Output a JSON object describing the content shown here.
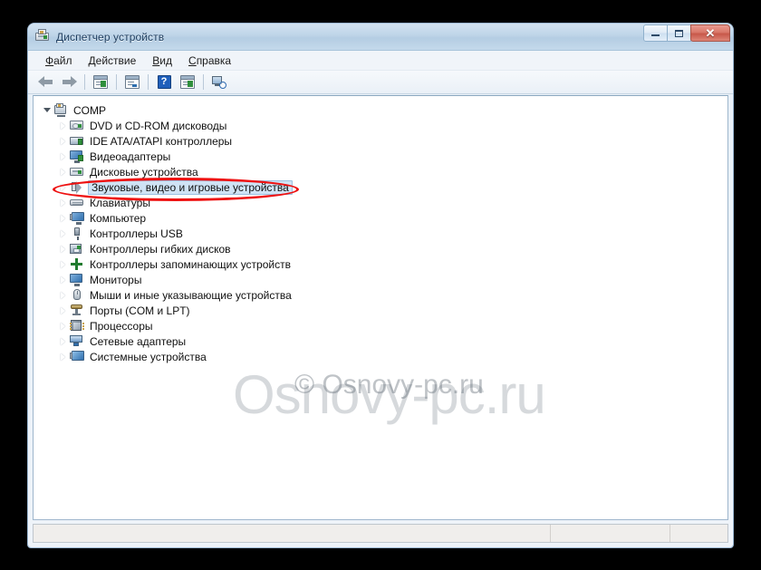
{
  "window": {
    "title": "Диспетчер устройств",
    "title_icon": "device-manager-icon",
    "controls": {
      "minimize": "minimize-button",
      "maximize": "maximize-button",
      "close": "✕"
    }
  },
  "menubar": {
    "items": [
      {
        "label": "Файл",
        "accel": "Ф",
        "rest": "айл"
      },
      {
        "label": "Действие",
        "accel": "Д",
        "rest": "ействие"
      },
      {
        "label": "Вид",
        "accel": "В",
        "rest": "ид"
      },
      {
        "label": "Справка",
        "accel": "С",
        "rest": "правка"
      }
    ]
  },
  "toolbar": {
    "buttons": [
      {
        "name": "back-button",
        "icon": "arrow-left-icon"
      },
      {
        "name": "forward-button",
        "icon": "arrow-right-icon"
      },
      {
        "name": "properties-button",
        "icon": "properties-panel-icon"
      },
      {
        "name": "show-details-button",
        "icon": "details-panel-icon"
      },
      {
        "name": "help-button",
        "icon": "help-icon",
        "glyph": "?"
      },
      {
        "name": "update-driver-button",
        "icon": "update-panel-icon"
      },
      {
        "name": "scan-hardware-button",
        "icon": "scan-hardware-icon"
      }
    ]
  },
  "tree": {
    "root": {
      "label": "COMP",
      "icon": "computer-icon",
      "expanded": true
    },
    "items": [
      {
        "label": "DVD и CD-ROM дисководы",
        "icon": "dvd-drive-icon",
        "selected": false
      },
      {
        "label": "IDE ATA/ATAPI контроллеры",
        "icon": "ide-controller-icon",
        "selected": false
      },
      {
        "label": "Видеоадаптеры",
        "icon": "display-adapter-icon",
        "selected": false
      },
      {
        "label": "Дисковые устройства",
        "icon": "disk-drive-icon",
        "selected": false
      },
      {
        "label": "Звуковые, видео и игровые устройства",
        "icon": "sound-device-icon",
        "selected": true
      },
      {
        "label": "Клавиатуры",
        "icon": "keyboard-icon",
        "selected": false
      },
      {
        "label": "Компьютер",
        "icon": "computer-node-icon",
        "selected": false
      },
      {
        "label": "Контроллеры USB",
        "icon": "usb-controller-icon",
        "selected": false
      },
      {
        "label": "Контроллеры гибких дисков",
        "icon": "floppy-controller-icon",
        "selected": false
      },
      {
        "label": "Контроллеры запоминающих устройств",
        "icon": "storage-controller-icon",
        "selected": false
      },
      {
        "label": "Мониторы",
        "icon": "monitor-icon",
        "selected": false
      },
      {
        "label": "Мыши и иные указывающие устройства",
        "icon": "mouse-icon",
        "selected": false
      },
      {
        "label": "Порты (COM и LPT)",
        "icon": "port-icon",
        "selected": false
      },
      {
        "label": "Процессоры",
        "icon": "cpu-icon",
        "selected": false
      },
      {
        "label": "Сетевые адаптеры",
        "icon": "network-adapter-icon",
        "selected": false
      },
      {
        "label": "Системные устройства",
        "icon": "system-device-icon",
        "selected": false
      }
    ]
  },
  "annotation": {
    "type": "red-ellipse-highlight",
    "target": "Звуковые, видео и игровые устройства",
    "color": "#ee1111"
  },
  "watermark": {
    "large": "Osnovy-pc.ru",
    "small": "© Osnovy-pc.ru"
  },
  "statusbar": {
    "pane1": "",
    "pane2": "",
    "pane3": ""
  }
}
